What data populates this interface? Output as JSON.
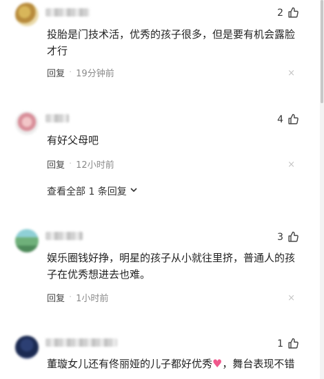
{
  "comments": [
    {
      "likes": "2",
      "text": "投胎是门技术活，优秀的孩子很多，但是要有机会露脸才行",
      "reply_label": "回复",
      "time": "19分钟前"
    },
    {
      "likes": "4",
      "text": "有好父母吧",
      "reply_label": "回复",
      "time": "12小时前",
      "view_all": "查看全部 1 条回复"
    },
    {
      "likes": "3",
      "text": "娱乐圈钱好挣，明星的孩子从小就往里挤，普通人的孩子在优秀想进去也难。",
      "reply_label": "回复",
      "time": "1小时前"
    },
    {
      "likes": "1",
      "text_before": "董璇女儿还有佟丽娅的儿子都好优秀",
      "text_after": "，舞台表现不错"
    }
  ],
  "separator": "·",
  "close_glyph": "×",
  "heart_glyph": "♥",
  "icons": {
    "like": "thumbs-up-icon",
    "close": "close-icon",
    "chevron": "chevron-down-icon",
    "heart": "heart-icon"
  },
  "colors": {
    "text": "#222222",
    "meta": "#8a8a8a",
    "heart": "#f0588c",
    "close": "#c4c4c4"
  }
}
